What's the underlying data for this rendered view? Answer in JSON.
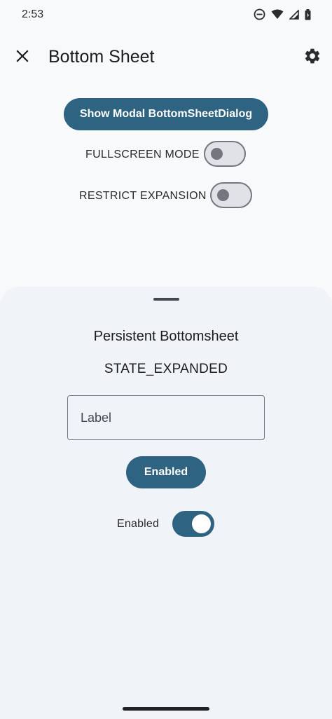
{
  "status_bar": {
    "time": "2:53",
    "icons": [
      "do-not-disturb-icon",
      "wifi-icon",
      "signal-icon",
      "battery-icon"
    ]
  },
  "app_bar": {
    "title": "Bottom Sheet",
    "close_icon": "close-icon",
    "settings_icon": "gear-icon"
  },
  "controls": {
    "show_modal_label": "Show Modal BottomSheetDialog",
    "fullscreen": {
      "label": "FULLSCREEN MODE",
      "on": false
    },
    "restrict": {
      "label": "RESTRICT EXPANSION",
      "on": false
    }
  },
  "bottom_sheet": {
    "title": "Persistent Bottomsheet",
    "state": "STATE_EXPANDED",
    "label_field": {
      "placeholder": "Label",
      "value": ""
    },
    "enabled_button_label": "Enabled",
    "enabled_switch": {
      "label": "Enabled",
      "on": true
    }
  },
  "colors": {
    "primary": "#2e6381",
    "background": "#f8f9fb",
    "sheet_background": "#f0f3f7",
    "outline": "#74777f"
  }
}
